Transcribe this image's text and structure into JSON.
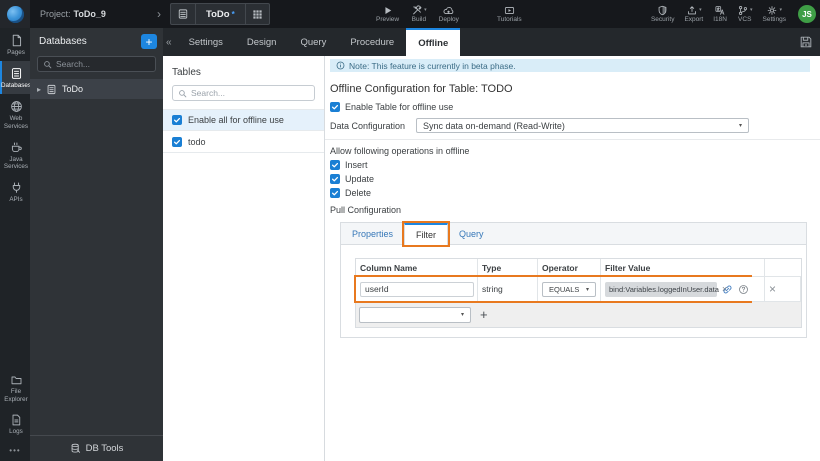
{
  "topbar": {
    "project_prefix": "Project:",
    "project_name": "ToDo_9",
    "doc_tab": "ToDo",
    "actions": [
      "Preview",
      "Build",
      "Deploy"
    ],
    "tutorials_label": "Tutorials",
    "right_actions": [
      "Security",
      "Export",
      "I18N",
      "VCS",
      "Settings"
    ],
    "avatar_initials": "JS"
  },
  "rail": {
    "items": [
      "Pages",
      "Databases",
      "Web Services",
      "Java Services",
      "APIs"
    ],
    "active_item": "Databases",
    "bottom_items": [
      "File Explorer",
      "Logs"
    ],
    "more_label": "•••"
  },
  "databases_panel": {
    "title": "Databases",
    "add_label": "+",
    "search_placeholder": "Search...",
    "items": [
      "ToDo"
    ],
    "footer_label": "DB Tools"
  },
  "editor_tabs": {
    "collapse_glyph": "«",
    "tabs": [
      "Settings",
      "Design",
      "Query",
      "Procedure",
      "Offline"
    ],
    "active_tab": "Offline"
  },
  "tables_panel": {
    "title": "Tables",
    "search_placeholder": "Search...",
    "enable_all_label": "Enable all for offline use",
    "tables": [
      "todo"
    ]
  },
  "main": {
    "note_text": "Note: This feature is currently in beta phase.",
    "title": "Offline Configuration for Table: TODO",
    "enable_table_label": "Enable Table for offline use",
    "data_configuration": {
      "label": "Data Configuration",
      "value": "Sync data on-demand (Read-Write)"
    },
    "operations_label": "Allow following operations in offline",
    "operations": [
      "Insert",
      "Update",
      "Delete"
    ],
    "pull_configuration_label": "Pull Configuration",
    "pull_tabs": [
      "Properties",
      "Filter",
      "Query"
    ],
    "active_pull_tab": "Filter",
    "filter_table": {
      "headers": [
        "Column Name",
        "Type",
        "Operator",
        "Filter Value"
      ],
      "rows": [
        {
          "column_name": "userId",
          "type": "string",
          "operator": "EQUALS",
          "filter_value": "bind:Variables.loggedInUser.data"
        }
      ],
      "add_label": "+"
    }
  },
  "glyphs": {
    "chevron_right": "›",
    "caret_down": "▾",
    "caret_right": "▸",
    "close": "×",
    "dirty_marker": "*"
  },
  "colors": {
    "accent_blue": "#1d86e0",
    "annotation_orange": "#e8791f",
    "note_bg": "#d9edf8",
    "avatar_green": "#3f9e46",
    "topbar_bg": "#16181c",
    "panel_dark_bg": "#2f3337"
  }
}
